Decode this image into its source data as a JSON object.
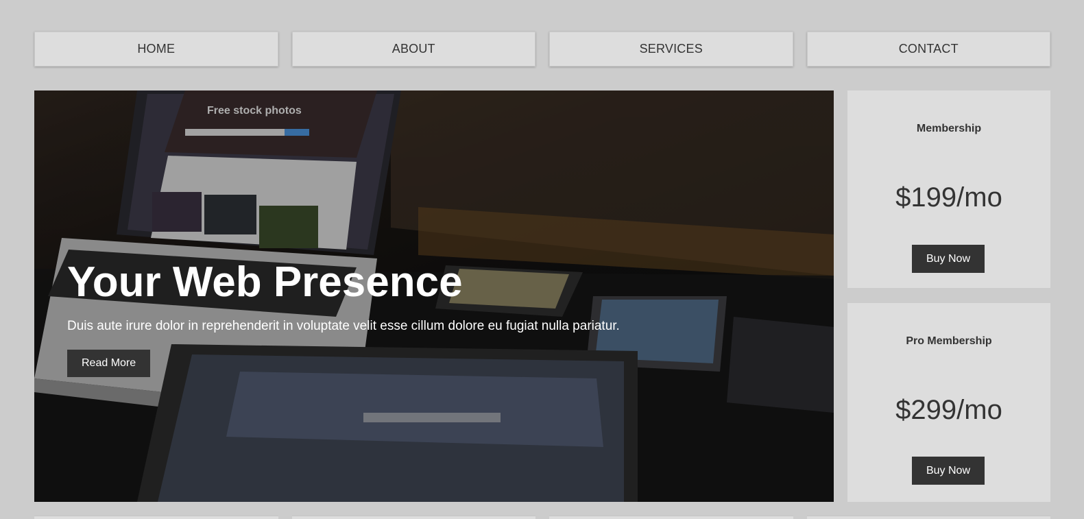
{
  "nav": {
    "items": [
      {
        "label": "HOME"
      },
      {
        "label": "ABOUT"
      },
      {
        "label": "SERVICES"
      },
      {
        "label": "CONTACT"
      }
    ]
  },
  "hero": {
    "title": "Your Web Presence",
    "text": "Duis aute irure dolor in reprehenderit in voluptate velit esse cillum dolore eu fugiat nulla pariatur.",
    "button_label": "Read More",
    "image_screen_heading": "Free stock photos"
  },
  "pricing": [
    {
      "title": "Membership",
      "price": "$199/mo",
      "button_label": "Buy Now"
    },
    {
      "title": "Pro Membership",
      "price": "$299/mo",
      "button_label": "Buy Now"
    }
  ],
  "colors": {
    "page_background": "#cccccc",
    "panel_background": "#dddddd",
    "button_background": "#333333",
    "text_dark": "#333333",
    "text_light": "#ffffff"
  }
}
